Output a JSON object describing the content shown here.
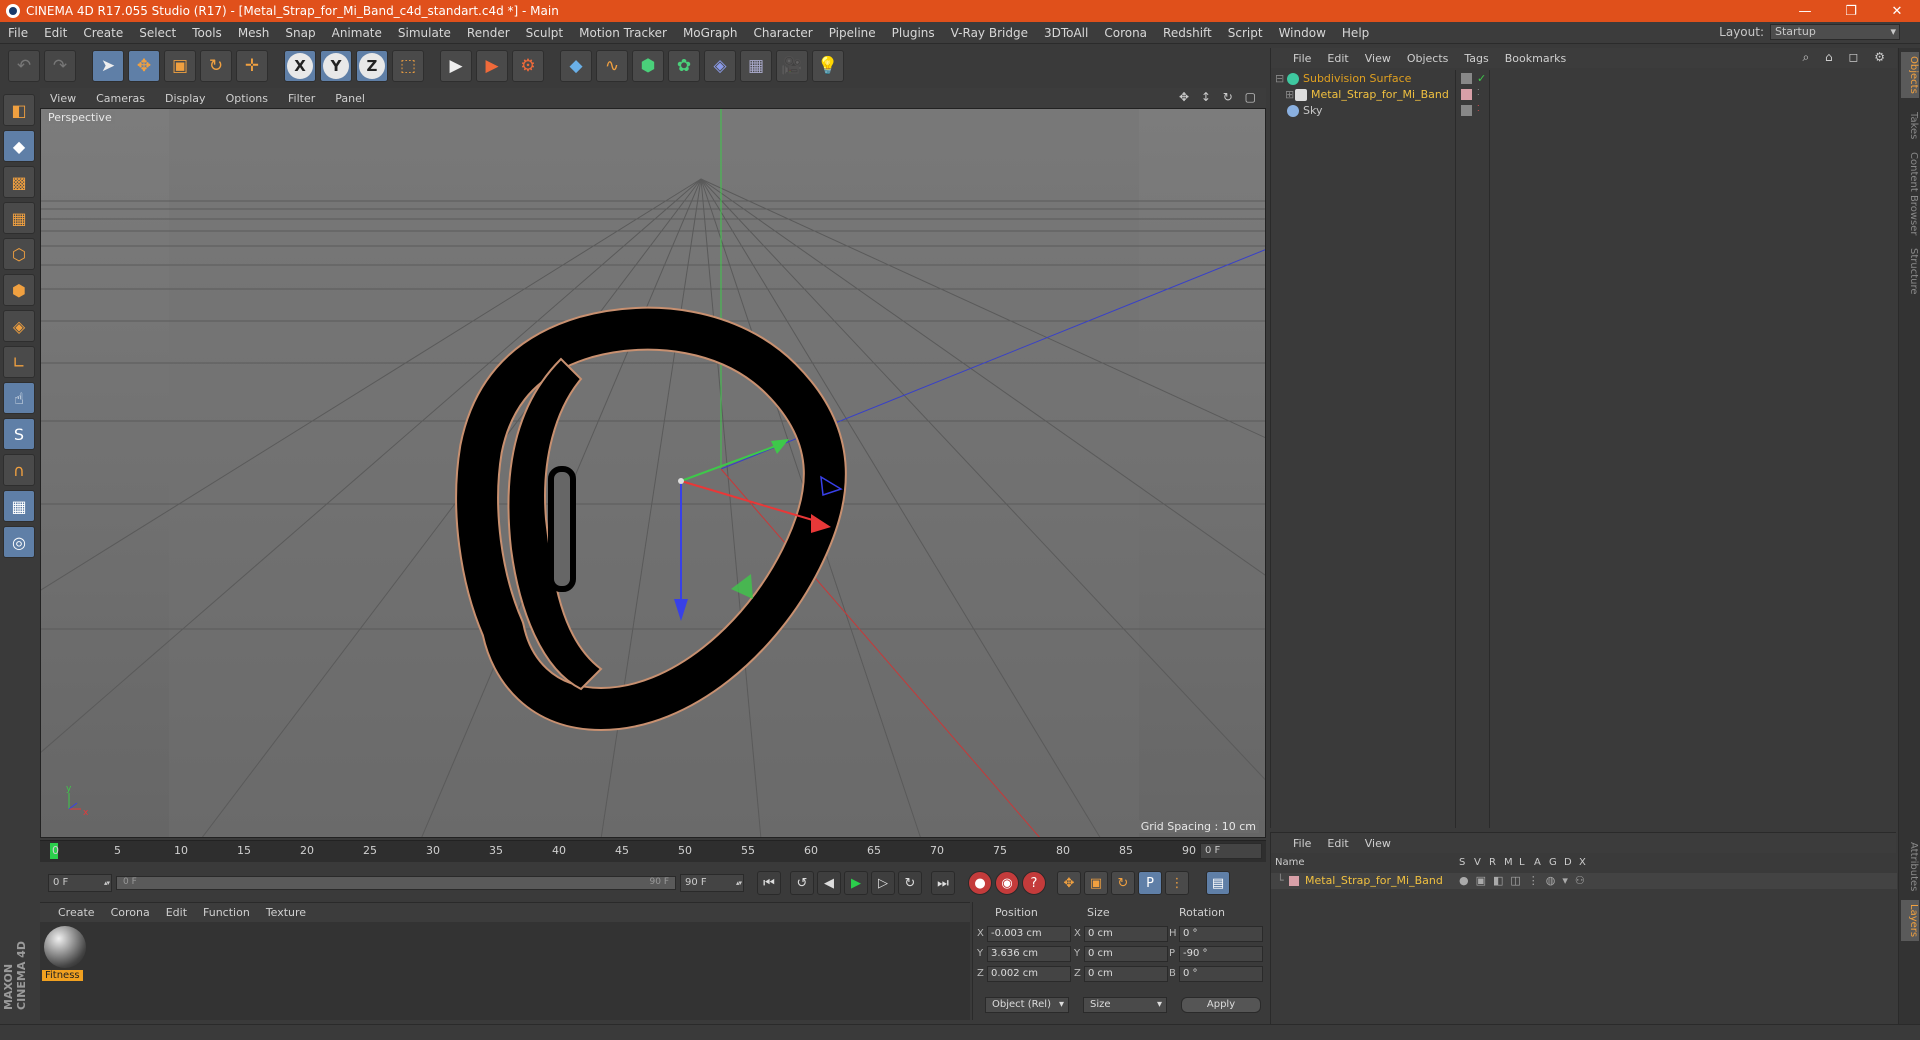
{
  "window": {
    "title": "CINEMA 4D R17.055 Studio (R17) - [Metal_Strap_for_Mi_Band_c4d_standart.c4d *] - Main",
    "minimize": "—",
    "restore": "❐",
    "close": "✕"
  },
  "menubar": [
    "File",
    "Edit",
    "Create",
    "Select",
    "Tools",
    "Mesh",
    "Snap",
    "Animate",
    "Simulate",
    "Render",
    "Sculpt",
    "Motion Tracker",
    "MoGraph",
    "Character",
    "Pipeline",
    "Plugins",
    "V-Ray Bridge",
    "3DToAll",
    "Corona",
    "Redshift",
    "Script",
    "Window",
    "Help"
  ],
  "layout": {
    "label": "Layout:",
    "value": "Startup"
  },
  "toolbar": {
    "undo": "↶",
    "redo": "↷",
    "select": "➤",
    "move": "✥",
    "scale": "▣",
    "rotate": "↻",
    "place": "✛",
    "axis_x": "X",
    "axis_y": "Y",
    "axis_z": "Z",
    "coords": "⬚",
    "render_view": "▶",
    "render_pv": "▶",
    "render_settings": "⚙",
    "cube": "◆",
    "spline": "∿",
    "subdiv": "⬢",
    "array": "✿",
    "deform": "◈",
    "floor": "▦",
    "camera": "🎥",
    "light": "💡"
  },
  "viewport": {
    "menu": [
      "View",
      "Cameras",
      "Display",
      "Options",
      "Filter",
      "Panel"
    ],
    "icons": "✥ ↕ ↻ ▢",
    "label": "Perspective",
    "grid_spacing": "Grid Spacing : 10 cm"
  },
  "timeline": {
    "ticks": [
      "0",
      "5",
      "10",
      "15",
      "20",
      "25",
      "30",
      "35",
      "40",
      "45",
      "50",
      "55",
      "60",
      "65",
      "70",
      "75",
      "80",
      "85",
      "90"
    ],
    "current_frame": "0 F",
    "start_field": "0 F",
    "range_start": "0 F",
    "range_end": "90 F",
    "end_field": "90 F"
  },
  "material_manager": {
    "menu": [
      "Create",
      "Corona",
      "Edit",
      "Function",
      "Texture"
    ],
    "material_name": "Fitness"
  },
  "coordinates": {
    "headers": {
      "position": "Position",
      "size": "Size",
      "rotation": "Rotation"
    },
    "pos": {
      "x": "-0.003 cm",
      "y": "3.636 cm",
      "z": "0.002 cm"
    },
    "size": {
      "x": "0 cm",
      "y": "0 cm",
      "z": "0 cm"
    },
    "rot": {
      "h": "0 °",
      "p": "-90 °",
      "b": "0 °"
    },
    "labels": {
      "x": "X",
      "y": "Y",
      "z": "Z",
      "h": "H",
      "p": "P",
      "b": "B"
    },
    "mode": "Object (Rel)",
    "size_mode": "Size",
    "apply": "Apply"
  },
  "object_manager": {
    "menu": [
      "File",
      "Edit",
      "View",
      "Objects",
      "Tags",
      "Bookmarks"
    ],
    "icons": "⌕ ⌂ ◻ ⚙",
    "objects": [
      {
        "name": "Subdivision Surface",
        "color": "#e0a020"
      },
      {
        "name": "Metal_Strap_for_Mi_Band",
        "color": "#f0c040"
      },
      {
        "name": "Sky",
        "color": "#c8c8c8"
      }
    ]
  },
  "layer_manager": {
    "menu": [
      "File",
      "Edit",
      "View"
    ],
    "columns": [
      "Name",
      "S",
      "V",
      "R",
      "M",
      "L",
      "A",
      "G",
      "D",
      "X"
    ],
    "layer": {
      "name": "Metal_Strap_for_Mi_Band",
      "color": "#f0c040"
    }
  },
  "side_tabs": [
    "Objects",
    "Takes",
    "Content Browser",
    "Structure",
    "Attributes",
    "Layers"
  ],
  "brand": "MAXON CINEMA 4D"
}
